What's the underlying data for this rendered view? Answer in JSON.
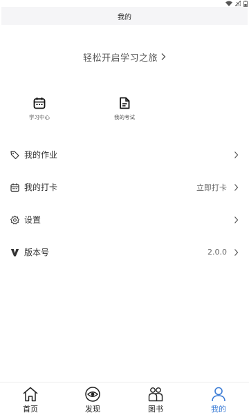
{
  "title_bar": {
    "title": "我的"
  },
  "promo": {
    "text": "轻松开启学习之旅"
  },
  "quick_entries": [
    {
      "icon": "calendar-icon",
      "label": "学习中心"
    },
    {
      "icon": "document-icon",
      "label": "我的考试"
    }
  ],
  "menu": [
    {
      "icon": "tag-icon",
      "label": "我的作业",
      "value": ""
    },
    {
      "icon": "calendar-icon",
      "label": "我的打卡",
      "value": "立即打卡"
    },
    {
      "icon": "settings-icon",
      "label": "设置",
      "value": ""
    },
    {
      "icon": "version-v-icon",
      "label": "版本号",
      "value": "2.0.0"
    }
  ],
  "tabbar": {
    "active": "我的",
    "accent_color": "#3a7bd5",
    "items": [
      {
        "icon": "home-icon",
        "label": "首页"
      },
      {
        "icon": "eye-icon",
        "label": "发现"
      },
      {
        "icon": "books-icon",
        "label": "图书"
      },
      {
        "icon": "user-icon",
        "label": "我的"
      }
    ]
  }
}
